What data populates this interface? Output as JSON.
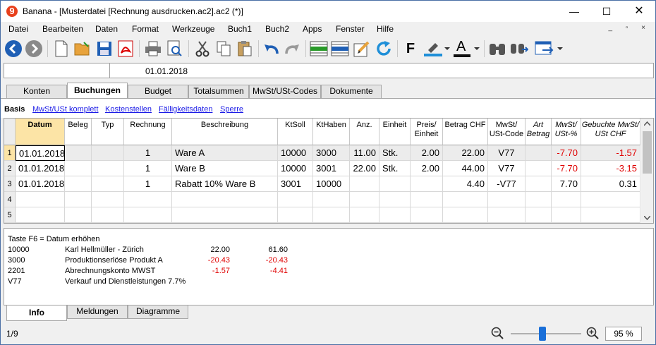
{
  "window": {
    "title": "Banana - [Musterdatei [Rechnung ausdrucken.ac2].ac2 (*)]",
    "app_icon_text": "9",
    "minimize": "—",
    "maximize": "☐",
    "close": "✕"
  },
  "menu": [
    {
      "label": "Datei"
    },
    {
      "label": "Bearbeiten"
    },
    {
      "label": "Daten"
    },
    {
      "label": "Format"
    },
    {
      "label": "Werkzeuge"
    },
    {
      "label": "Buch1"
    },
    {
      "label": "Buch2"
    },
    {
      "label": "Apps"
    },
    {
      "label": "Fenster"
    },
    {
      "label": "Hilfe"
    }
  ],
  "mdi_controls": "_ ▫ ×",
  "toolbar": {
    "icons": [
      "back-icon",
      "forward-icon",
      "new-file-icon",
      "open-folder-icon",
      "save-icon",
      "pdf-icon",
      "print-icon",
      "print-preview-icon",
      "cut-icon",
      "copy-icon",
      "paste-icon",
      "undo-icon",
      "redo-icon",
      "insert-row-icon",
      "delete-row-icon",
      "edit-icon",
      "refresh-icon",
      "bold-icon",
      "highlight-icon",
      "font-color-icon",
      "find-icon",
      "find-next-icon",
      "export-icon"
    ],
    "bold_label": "F",
    "font_color_label": "A",
    "accent_blue": "#1f5fb5",
    "accent_orange": "#e8a33c"
  },
  "cell_editor": {
    "reference": "",
    "value": "01.01.2018"
  },
  "tables": [
    {
      "label": "Konten"
    },
    {
      "label": "Buchungen"
    },
    {
      "label": "Budget"
    },
    {
      "label": "Totalsummen"
    },
    {
      "label": "MwSt/USt-Codes"
    },
    {
      "label": "Dokumente"
    }
  ],
  "views": [
    {
      "label": "Basis"
    },
    {
      "label": "MwSt/USt komplett"
    },
    {
      "label": "Kostenstellen"
    },
    {
      "label": "Fälligkeitsdaten"
    },
    {
      "label": "Sperre"
    }
  ],
  "columns": [
    {
      "line1": "Datum",
      "line2": ""
    },
    {
      "line1": "Beleg",
      "line2": ""
    },
    {
      "line1": "Typ",
      "line2": ""
    },
    {
      "line1": "Rechnung",
      "line2": ""
    },
    {
      "line1": "Beschreibung",
      "line2": ""
    },
    {
      "line1": "KtSoll",
      "line2": ""
    },
    {
      "line1": "KtHaben",
      "line2": ""
    },
    {
      "line1": "Anz.",
      "line2": ""
    },
    {
      "line1": "Einheit",
      "line2": ""
    },
    {
      "line1": "Preis/",
      "line2": "Einheit"
    },
    {
      "line1": "Betrag CHF",
      "line2": ""
    },
    {
      "line1": "MwSt/",
      "line2": "USt-Code"
    },
    {
      "line1": "Art",
      "line2": "Betrag"
    },
    {
      "line1": "MwSt/",
      "line2": "USt-%"
    },
    {
      "line1": "Gebuchte MwSt/",
      "line2": "USt CHF"
    }
  ],
  "rows": [
    {
      "num": "1",
      "cells": [
        "01.01.2018",
        "",
        "",
        "1",
        "Ware A",
        "10000",
        "3000",
        "11.00",
        "Stk.",
        "2.00",
        "22.00",
        "V77",
        "",
        "-7.70",
        "-1.57"
      ]
    },
    {
      "num": "2",
      "cells": [
        "01.01.2018",
        "",
        "",
        "1",
        "Ware B",
        "10000",
        "3001",
        "22.00",
        "Stk.",
        "2.00",
        "44.00",
        "V77",
        "",
        "-7.70",
        "-3.15"
      ]
    },
    {
      "num": "3",
      "cells": [
        "01.01.2018",
        "",
        "",
        "1",
        "Rabatt 10% Ware B",
        "3001",
        "10000",
        "",
        "",
        "",
        "4.40",
        "-V77",
        "",
        "7.70",
        "0.31"
      ]
    },
    {
      "num": "4",
      "cells": [
        "",
        "",
        "",
        "",
        "",
        "",
        "",
        "",
        "",
        "",
        "",
        "",
        "",
        "",
        ""
      ]
    },
    {
      "num": "5",
      "cells": [
        "",
        "",
        "",
        "",
        "",
        "",
        "",
        "",
        "",
        "",
        "",
        "",
        "",
        "",
        ""
      ]
    }
  ],
  "negative_color": "#e00000",
  "selected_header_color": "#fce4a6",
  "info": {
    "hint": "Taste F6 = Datum erhöhen",
    "lines": [
      {
        "code": "10000",
        "text": "Karl Hellmüller - Zürich",
        "amount": "22.00",
        "balance": "61.60"
      },
      {
        "code": "3000",
        "text": "Produktionserlöse Produkt A",
        "amount": "-20.43",
        "balance": "-20.43"
      },
      {
        "code": "2201",
        "text": "Abrechnungskonto MWST",
        "amount": "-1.57",
        "balance": "-4.41"
      },
      {
        "code": "V77",
        "text": "Verkauf und Dienstleistungen 7.7%",
        "amount": "",
        "balance": ""
      }
    ]
  },
  "bottom_tabs": [
    {
      "label": "Info"
    },
    {
      "label": "Meldungen"
    },
    {
      "label": "Diagramme"
    }
  ],
  "status": {
    "row_count": "1/9",
    "zoom_level": "95 %",
    "zoom_fraction": 0.45
  }
}
